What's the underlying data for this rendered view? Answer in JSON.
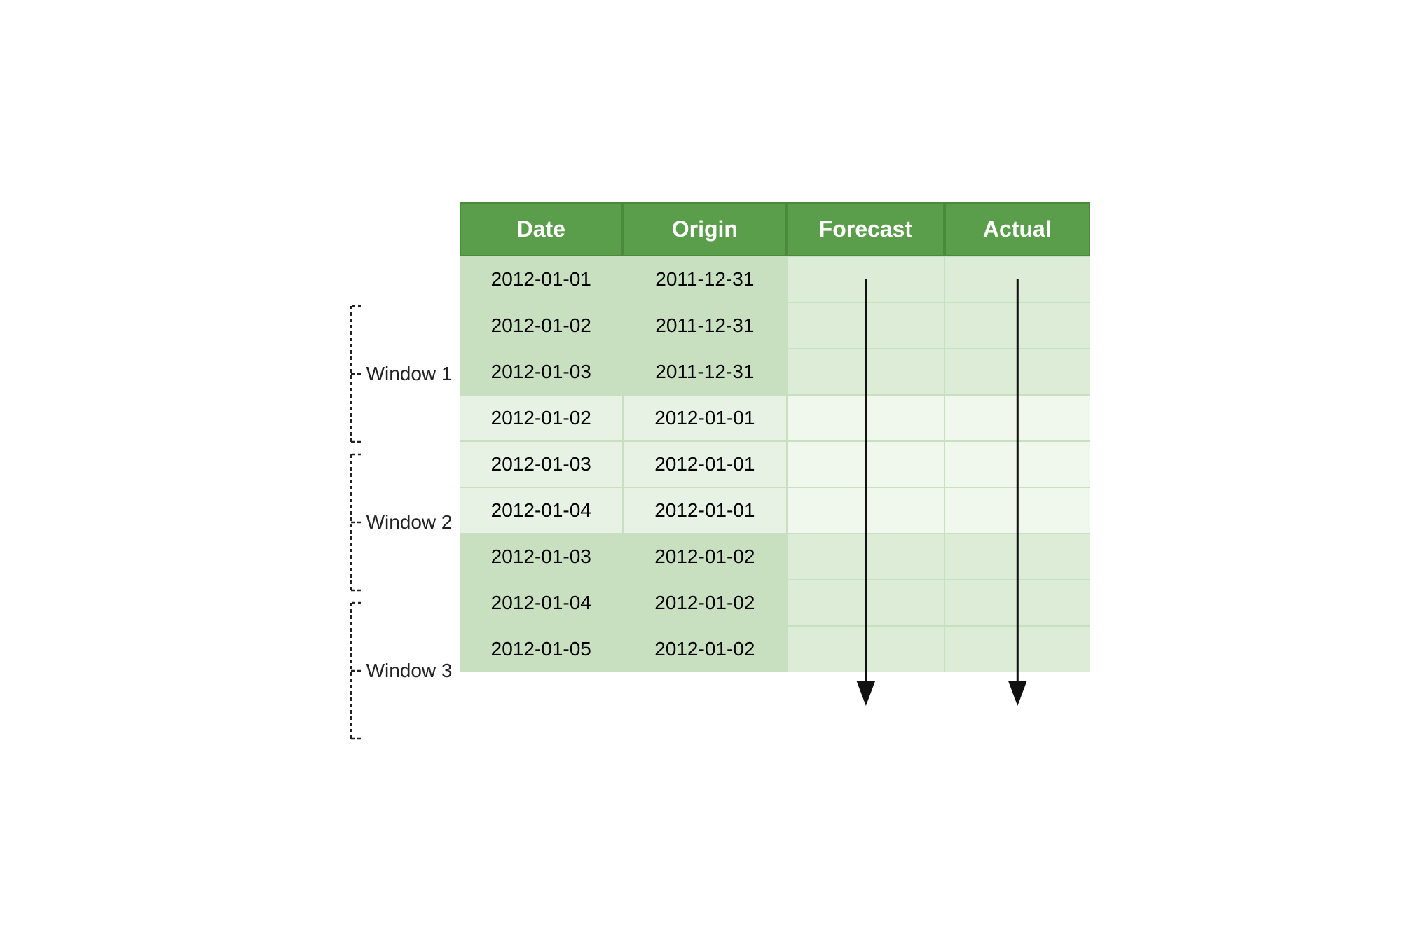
{
  "table": {
    "headers": [
      "Date",
      "Origin",
      "Forecast",
      "Actual"
    ],
    "rows": [
      {
        "date": "2012-01-01",
        "origin": "2011-12-31",
        "window": 1
      },
      {
        "date": "2012-01-02",
        "origin": "2011-12-31",
        "window": 1
      },
      {
        "date": "2012-01-03",
        "origin": "2011-12-31",
        "window": 1
      },
      {
        "date": "2012-01-02",
        "origin": "2012-01-01",
        "window": 2
      },
      {
        "date": "2012-01-03",
        "origin": "2012-01-01",
        "window": 2
      },
      {
        "date": "2012-01-04",
        "origin": "2012-01-01",
        "window": 2
      },
      {
        "date": "2012-01-03",
        "origin": "2012-01-02",
        "window": 3
      },
      {
        "date": "2012-01-04",
        "origin": "2012-01-02",
        "window": 3
      },
      {
        "date": "2012-01-05",
        "origin": "2012-01-02",
        "window": 3
      }
    ]
  },
  "windows": [
    {
      "label": "Window 1"
    },
    {
      "label": "Window 2"
    },
    {
      "label": "Window 3"
    }
  ],
  "colors": {
    "header_bg": "#5a9e4b",
    "header_text": "#ffffff",
    "row_dark": "#c8dfc0",
    "row_light": "#e8f2e4",
    "forecast_dark": "#ddecd7",
    "forecast_light": "#f0f7ed"
  }
}
